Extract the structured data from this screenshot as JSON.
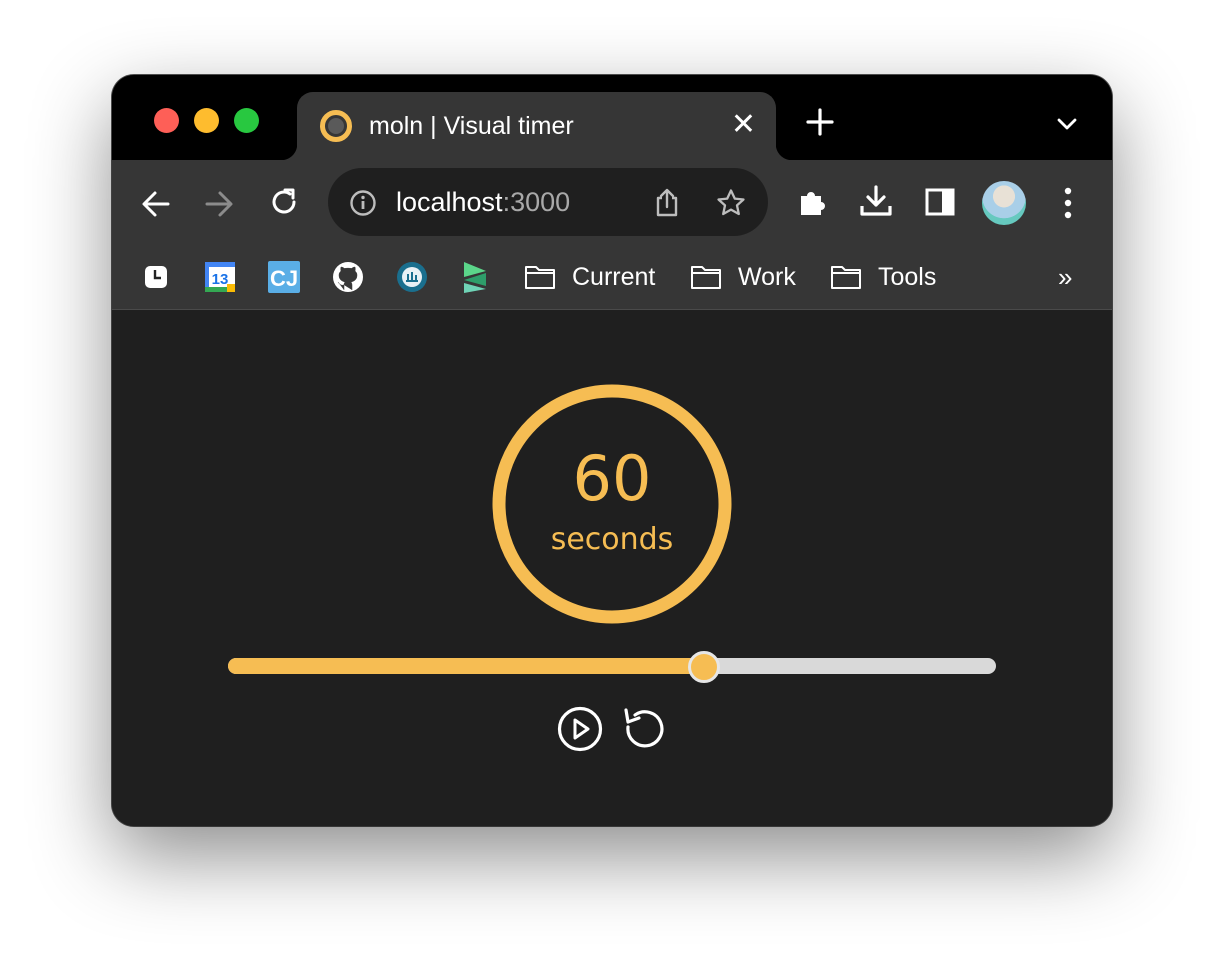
{
  "window": {
    "traffic_lights": [
      "close",
      "minimize",
      "zoom"
    ]
  },
  "tab": {
    "title": "moln | Visual timer",
    "close_glyph": "✕",
    "favicon": "ring-icon"
  },
  "toolbar": {
    "url_host": "localhost",
    "url_port": ":3000"
  },
  "bookmarks": {
    "calendar_day": "13",
    "cj_label": "CJ",
    "folders": [
      "Current",
      "Work",
      "Tools"
    ],
    "overflow": "»"
  },
  "timer": {
    "value": "60",
    "unit": "seconds",
    "slider_fraction": 0.62,
    "accent_color": "#f6bd53"
  }
}
